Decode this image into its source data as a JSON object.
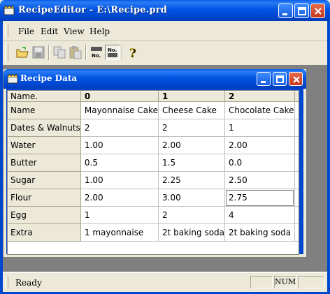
{
  "window": {
    "title": "RecipeEditor - E:\\Recipe.prd"
  },
  "menu": {
    "file": "File",
    "edit": "Edit",
    "view": "View",
    "help": "Help"
  },
  "toolbar": {
    "buttons": [
      "open-icon",
      "save-icon",
      "copy-icon",
      "paste-icon",
      "number-icon",
      "number-view-icon",
      "help-icon"
    ]
  },
  "child": {
    "title": "Recipe Data"
  },
  "grid": {
    "corner": "Name.",
    "columns": [
      "0",
      "1",
      "2"
    ],
    "rows": [
      {
        "label": "Name",
        "cells": [
          "Mayonnaise Cake",
          "Cheese Cake",
          "Chocolate Cake"
        ]
      },
      {
        "label": "Dates & Walnuts",
        "cells": [
          "2",
          "2",
          "1"
        ]
      },
      {
        "label": "Water",
        "cells": [
          "1.00",
          "2.00",
          "2.00"
        ]
      },
      {
        "label": "Butter",
        "cells": [
          "0.5",
          "1.5",
          "0.0"
        ]
      },
      {
        "label": "Sugar",
        "cells": [
          "1.00",
          "2.25",
          "2.50"
        ]
      },
      {
        "label": "Flour",
        "cells": [
          "2.00",
          "3.00",
          "2.75"
        ]
      },
      {
        "label": "Egg",
        "cells": [
          "1",
          "2",
          "4"
        ]
      },
      {
        "label": "Extra",
        "cells": [
          "1 mayonnaise",
          "2t baking soda",
          "2t baking soda"
        ]
      }
    ]
  },
  "status": {
    "text": "Ready",
    "num": "NUM"
  },
  "colors": {
    "titlebar": "#0054e3",
    "face": "#ece9d8",
    "mdi": "#808080"
  }
}
